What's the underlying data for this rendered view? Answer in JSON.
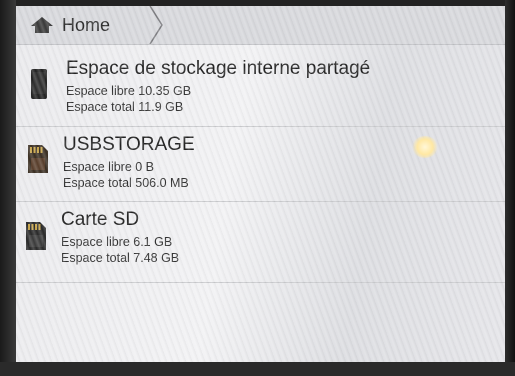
{
  "breadcrumb": {
    "home_label": "Home",
    "icon": "home-icon"
  },
  "storage": [
    {
      "icon": "phone-storage-icon",
      "title": "Espace de stockage interne partagé",
      "free": "Espace libre 10.35 GB",
      "total": "Espace total 11.9 GB"
    },
    {
      "icon": "sd-card-icon",
      "title": "USBSTORAGE",
      "free": "Espace libre 0 B",
      "total": "Espace total 506.0 MB"
    },
    {
      "icon": "sd-card-icon",
      "title": "Carte SD",
      "free": "Espace libre 6.1 GB",
      "total": "Espace total 7.48 GB"
    }
  ],
  "colors": {
    "background": "#eaeaed",
    "breadcrumb_bar": "#d7d8dc",
    "text": "#1e1e1e",
    "sd_card_gold": "#c9a64a"
  }
}
